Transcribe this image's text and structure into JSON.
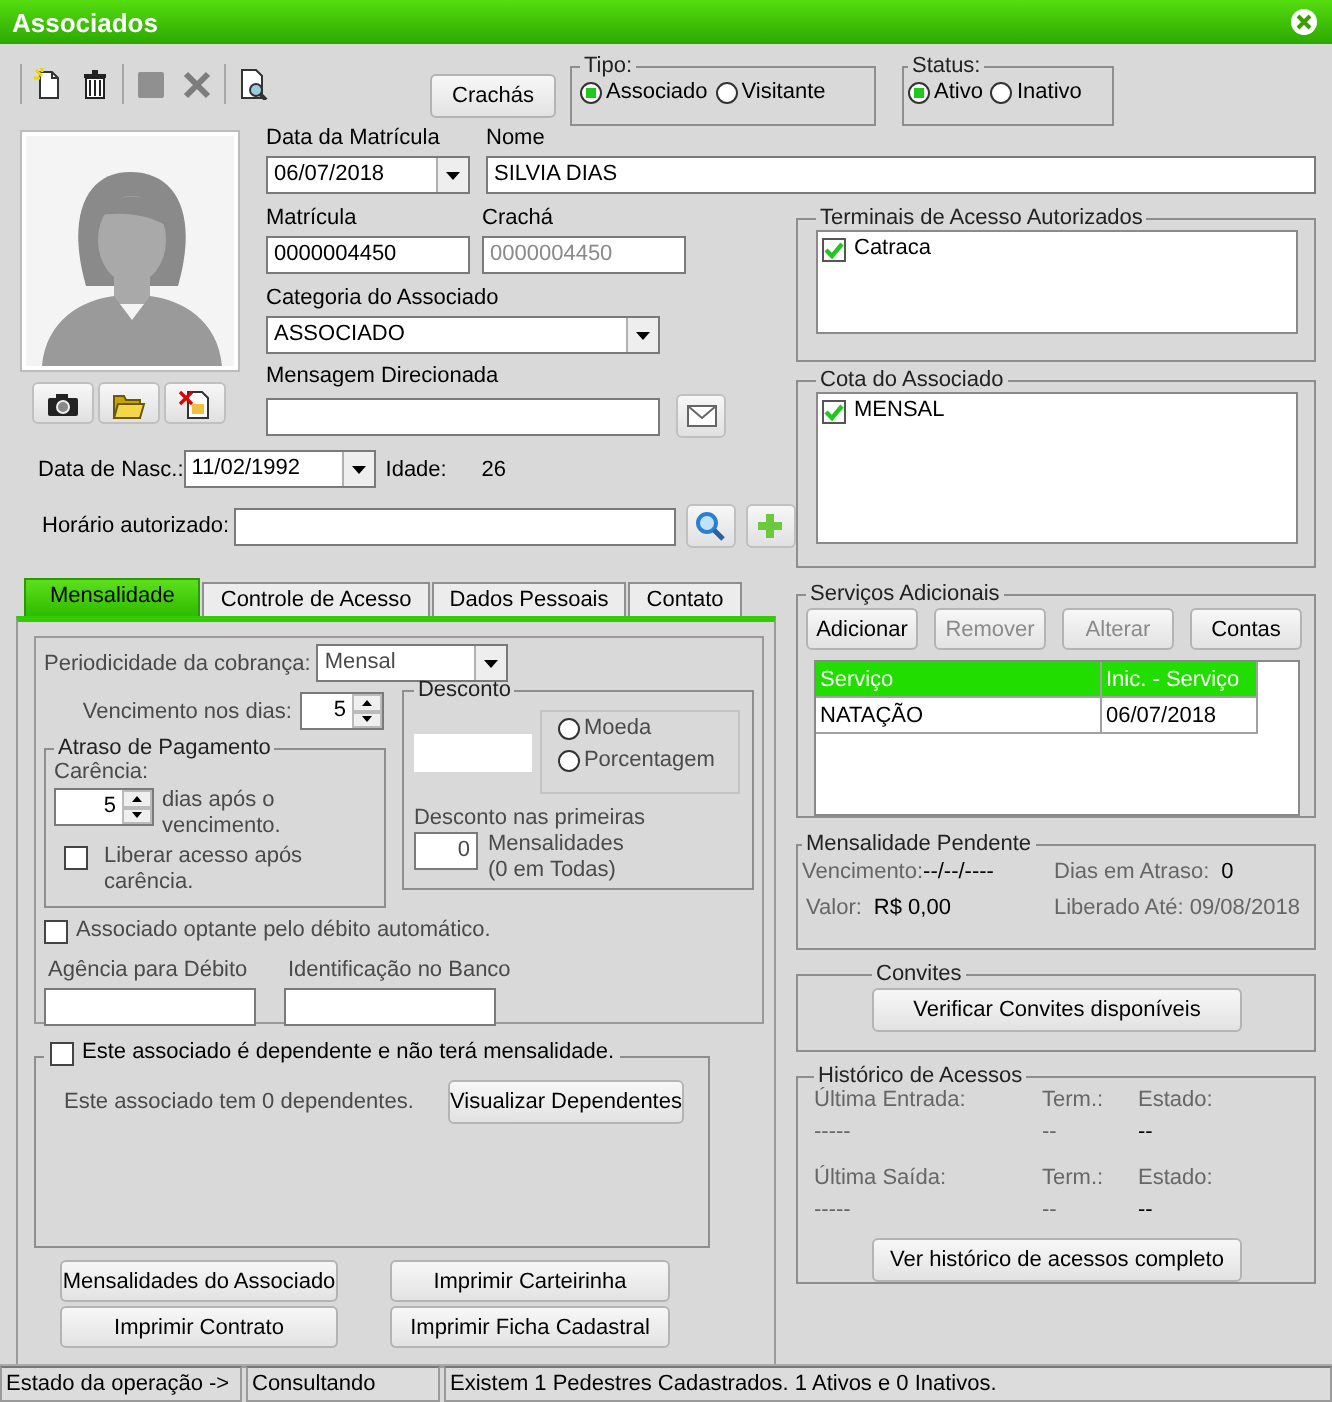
{
  "window": {
    "title": "Associados"
  },
  "toolbar_groups": [
    {
      "buttons": [
        {
          "kind": "new",
          "disabled": false
        },
        {
          "kind": "delete",
          "disabled": false
        }
      ]
    },
    {
      "buttons": [
        {
          "kind": "save",
          "disabled": true
        },
        {
          "kind": "cancel",
          "disabled": true
        }
      ]
    },
    {
      "buttons": [
        {
          "kind": "preview",
          "disabled": false
        }
      ]
    }
  ],
  "crachas_button": "Crachás",
  "tipo": {
    "label": "Tipo:",
    "options": [
      {
        "label": "Associado",
        "selected": true
      },
      {
        "label": "Visitante",
        "selected": false
      }
    ]
  },
  "status": {
    "label": "Status:",
    "options": [
      {
        "label": "Ativo",
        "selected": true
      },
      {
        "label": "Inativo",
        "selected": false
      }
    ]
  },
  "photo_buttons": [
    {
      "kind": "camera"
    },
    {
      "kind": "folder"
    },
    {
      "kind": "remove"
    }
  ],
  "data_matricula": {
    "label": "Data da Matrícula",
    "value": "06/07/2018"
  },
  "nome": {
    "label": "Nome",
    "value": "SILVIA DIAS"
  },
  "matricula": {
    "label": "Matrícula",
    "value": "0000004450"
  },
  "cracha": {
    "label": "Crachá",
    "value": "0000004450",
    "disabled": true
  },
  "categoria": {
    "label": "Categoria do Associado",
    "value": "ASSOCIADO"
  },
  "mensagem": {
    "label": "Mensagem Direcionada"
  },
  "data_nasc": {
    "label": "Data de Nasc.:",
    "value": "11/02/1992"
  },
  "idade": {
    "label": "Idade:",
    "value": "26"
  },
  "horario": {
    "label": "Horário autorizado:"
  },
  "tabs": [
    {
      "label": "Mensalidade",
      "selected": true
    },
    {
      "label": "Controle de Acesso",
      "selected": false
    },
    {
      "label": "Dados Pessoais",
      "selected": false
    },
    {
      "label": "Contato",
      "selected": false
    }
  ],
  "mensalidade": {
    "periodicidade": {
      "label": "Periodicidade da cobrança:",
      "value": "Mensal"
    },
    "vencimento": {
      "label": "Vencimento nos dias:",
      "value": "5"
    },
    "atraso": {
      "title": "Atraso de Pagamento",
      "carencia_label": "Carência:",
      "carencia": "5",
      "dias_text": "dias após o vencimento.",
      "liberar": {
        "label": "Liberar acesso após carência.",
        "checked": false
      }
    },
    "desconto": {
      "title": "Desconto",
      "options": [
        {
          "label": "Moeda",
          "selected": false
        },
        {
          "label": "Porcentagem",
          "selected": false
        }
      ],
      "primeiras_label": "Desconto nas primeiras",
      "primeiras": "0",
      "mensalidades_text": "Mensalidades (0 em Todas)"
    },
    "debito": {
      "label": "Associado optante pelo débito automático.",
      "checked": false
    },
    "agencia_label": "Agência para Débito",
    "identificacao_label": "Identificação no Banco"
  },
  "dependente": {
    "label": "Este associado é dependente e não terá mensalidade.",
    "checked": false,
    "info": "Este associado tem 0 dependentes.",
    "button": "Visualizar Dependentes"
  },
  "bottom_buttons": [
    "Mensalidades do Associado",
    "Imprimir Carteirinha",
    "Imprimir Contrato",
    "Imprimir Ficha Cadastral"
  ],
  "terminais": {
    "title": "Terminais de Acesso Autorizados",
    "items": [
      {
        "label": "Catraca",
        "checked": true
      }
    ]
  },
  "cota": {
    "title": "Cota do Associado",
    "items": [
      {
        "label": "MENSAL",
        "checked": true
      }
    ]
  },
  "servicos": {
    "title": "Serviços Adicionais",
    "buttons": [
      {
        "label": "Adicionar",
        "disabled": false
      },
      {
        "label": "Remover",
        "disabled": true
      },
      {
        "label": "Alterar",
        "disabled": true
      },
      {
        "label": "Contas",
        "disabled": false
      }
    ],
    "table": {
      "columns": [
        "Serviço",
        "Inic. - Serviço"
      ],
      "rows": [
        [
          "NATAÇÃO",
          "06/07/2018"
        ]
      ]
    }
  },
  "mensalidade_pendente": {
    "title": "Mensalidade Pendente",
    "vencimento_label": "Vencimento:",
    "vencimento": "--/--/----",
    "dias_label": "Dias em Atraso:",
    "dias": "0",
    "valor_label": "Valor:",
    "valor": "R$ 0,00",
    "liberado": "Liberado Até: 09/08/2018"
  },
  "convites": {
    "title": "Convites",
    "button": "Verificar Convites disponíveis"
  },
  "historico": {
    "title": "Histórico de Acessos",
    "rows": [
      {
        "label": "Última Entrada:",
        "value": "-----",
        "term_label": "Term.:",
        "term": "--",
        "estado_label": "Estado:",
        "estado": "--"
      },
      {
        "label": "Última Saída:",
        "value": "-----",
        "term_label": "Term.:",
        "term": "--",
        "estado_label": "Estado:",
        "estado": "--"
      }
    ],
    "button": "Ver histórico de acessos completo"
  },
  "status_bar": [
    "Estado da operação ->",
    "Consultando",
    "Existem 1 Pedestres Cadastrados. 1 Ativos e 0 Inativos."
  ]
}
